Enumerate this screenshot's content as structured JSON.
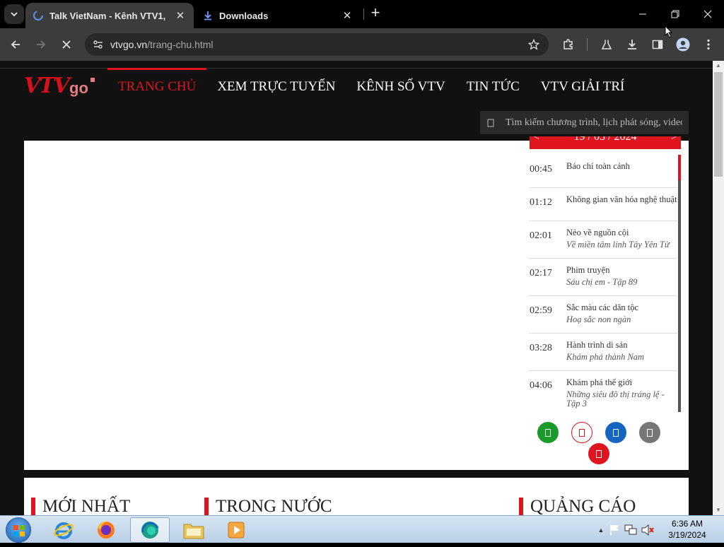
{
  "browser": {
    "tabs": [
      {
        "title": "Talk VietNam - Kênh VTV1,",
        "favicon": "vtvgo-spinner-icon",
        "active": true
      },
      {
        "title": "Downloads",
        "favicon": "download-icon",
        "active": false
      }
    ],
    "close_glyph": "✕",
    "new_tab_glyph": "+",
    "address": {
      "host": "vtvgo.vn",
      "path": "/trang-chu.html"
    }
  },
  "site": {
    "logo": {
      "main": "VTV",
      "suffix": "go"
    },
    "nav": [
      {
        "label": "TRANG CHỦ",
        "active": true
      },
      {
        "label": "XEM TRỰC TUYẾN",
        "active": false
      },
      {
        "label": "KÊNH SỐ VTV",
        "active": false
      },
      {
        "label": "TIN TỨC",
        "active": false
      },
      {
        "label": "VTV GIẢI TRÍ",
        "active": false
      }
    ],
    "search": {
      "placeholder": "Tìm kiếm chương trình, lịch phát sóng, video"
    },
    "schedule": {
      "date": "19 / 03 / 2024",
      "prev_glyph": "<",
      "next_glyph": ">",
      "items": [
        {
          "time": "00:45",
          "program": "Báo chí toàn cảnh",
          "episode": ""
        },
        {
          "time": "01:12",
          "program": "Không gian văn hóa nghệ thuật",
          "episode": ""
        },
        {
          "time": "02:01",
          "program": "Nẻo về nguồn cội",
          "episode": "Về miền tâm linh Tây Yên Tử"
        },
        {
          "time": "02:17",
          "program": "Phim truyện",
          "episode": "Sáu chị em - Tập 89"
        },
        {
          "time": "02:59",
          "program": "Sắc màu các dân tộc",
          "episode": "Hoạ sắc non ngàn"
        },
        {
          "time": "03:28",
          "program": "Hành trình di sản",
          "episode": "Khám phá thành Nam"
        },
        {
          "time": "04:06",
          "program": "Khám phá thế giới",
          "episode": "Những siêu đô thị tráng lệ - Tập 3"
        }
      ]
    },
    "share_buttons": [
      {
        "name": "share-green",
        "color": "#1a9a2a"
      },
      {
        "name": "share-outline-red",
        "color": "#e0141e"
      },
      {
        "name": "share-blue",
        "color": "#1565c0"
      },
      {
        "name": "share-gray",
        "color": "#777777"
      },
      {
        "name": "share-red",
        "color": "#e0141e"
      }
    ],
    "sections": [
      "MỚI NHẤT",
      "TRONG NƯỚC",
      "QUẢNG CÁO"
    ]
  },
  "taskbar": {
    "time": "6:36 AM",
    "date": "3/19/2024"
  },
  "colors": {
    "accent": "#e0141e",
    "chrome_dark": "#3c3c3c"
  }
}
